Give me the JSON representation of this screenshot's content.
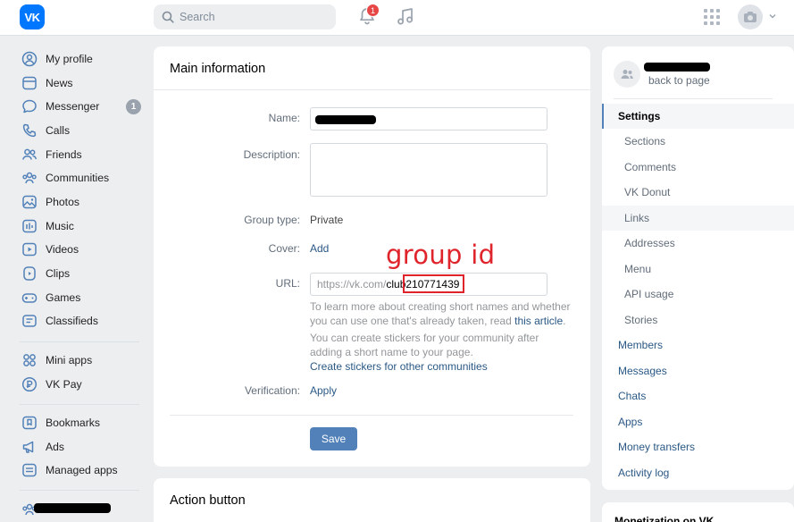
{
  "header": {
    "logo": "VK",
    "search_placeholder": "Search",
    "notifications_count": "1"
  },
  "sidebar": {
    "items": [
      {
        "label": "My profile",
        "icon": "user-circle-icon"
      },
      {
        "label": "News",
        "icon": "newspaper-icon"
      },
      {
        "label": "Messenger",
        "icon": "message-bubble-icon",
        "badge": "1"
      },
      {
        "label": "Calls",
        "icon": "phone-icon"
      },
      {
        "label": "Friends",
        "icon": "friends-icon"
      },
      {
        "label": "Communities",
        "icon": "communities-icon"
      },
      {
        "label": "Photos",
        "icon": "image-icon"
      },
      {
        "label": "Music",
        "icon": "music-bars-icon"
      },
      {
        "label": "Videos",
        "icon": "video-icon"
      },
      {
        "label": "Clips",
        "icon": "clip-icon"
      },
      {
        "label": "Games",
        "icon": "gamepad-icon"
      },
      {
        "label": "Classifieds",
        "icon": "classifieds-icon"
      },
      {
        "label": "Mini apps",
        "icon": "mini-apps-icon"
      },
      {
        "label": "VK Pay",
        "icon": "vk-pay-icon"
      },
      {
        "label": "Bookmarks",
        "icon": "bookmark-icon"
      },
      {
        "label": "Ads",
        "icon": "megaphone-icon"
      },
      {
        "label": "Managed apps",
        "icon": "managed-apps-icon"
      }
    ]
  },
  "main": {
    "title": "Main information",
    "fields": {
      "name_label": "Name:",
      "description_label": "Description:",
      "group_type_label": "Group type:",
      "group_type_value": "Private",
      "cover_label": "Cover:",
      "cover_value": "Add",
      "url_label": "URL:",
      "url_prefix": "https://vk.com/",
      "url_value": "club210771439",
      "verification_label": "Verification:",
      "verification_value": "Apply"
    },
    "help1": "To learn more about creating short names and whether you can use one that's already taken, read",
    "help1_link": "this article",
    "help2": "You can create stickers for your community after adding a short name to your page.",
    "help2_link": "Create stickers for other communities",
    "save_label": "Save",
    "action_title": "Action button"
  },
  "annotation": {
    "group_id_text": "group id",
    "color": "#e0242b"
  },
  "right": {
    "back_link": "back to page",
    "settings": "Settings",
    "sub_items": [
      "Sections",
      "Comments",
      "VK Donut",
      "Links",
      "Addresses",
      "Menu",
      "API usage",
      "Stories"
    ],
    "top_items": [
      "Members",
      "Messages",
      "Chats",
      "Apps",
      "Money transfers",
      "Activity log"
    ],
    "monetization": "Monetization on VK"
  },
  "colors": {
    "accent": "#5181b8",
    "link": "#2a5885",
    "brand": "#0077ff",
    "badge": "#e64646"
  }
}
